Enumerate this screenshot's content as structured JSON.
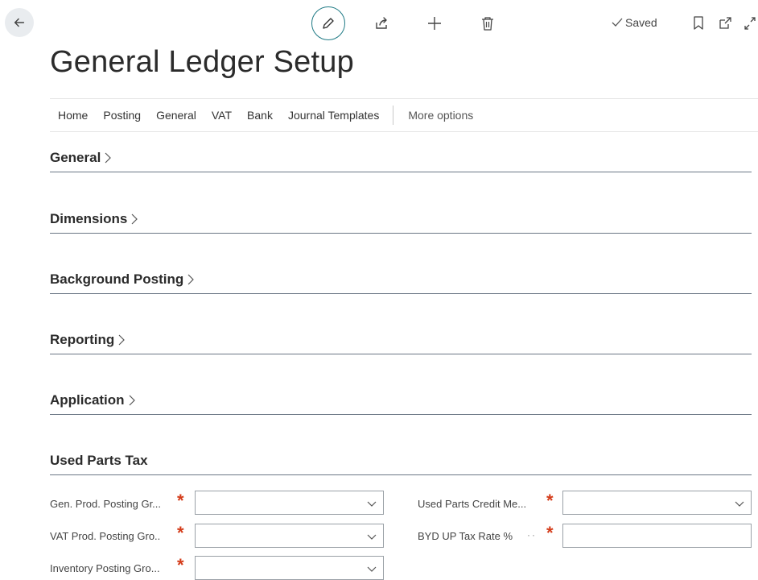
{
  "page": {
    "title": "General Ledger Setup",
    "status": "Saved"
  },
  "action_bar": {
    "items": [
      "Home",
      "Posting",
      "General",
      "VAT",
      "Bank",
      "Journal Templates"
    ],
    "more": "More options"
  },
  "fasttabs": [
    {
      "title": "General"
    },
    {
      "title": "Dimensions"
    },
    {
      "title": "Background Posting"
    },
    {
      "title": "Reporting"
    },
    {
      "title": "Application"
    },
    {
      "title": "Used Parts Tax"
    }
  ],
  "used_parts_tax": {
    "fields": [
      {
        "label": "Gen. Prod. Posting Gr...",
        "value": "",
        "required": "*"
      },
      {
        "label": "VAT Prod. Posting Gro..",
        "value": "",
        "required": "*"
      },
      {
        "label": "Inventory Posting Gro...",
        "value": "",
        "required": "*"
      },
      {
        "label": "Used Parts Credit Me...",
        "value": "",
        "required": "*"
      },
      {
        "label": "BYD UP Tax Rate %",
        "value": "",
        "required": "*"
      }
    ]
  },
  "icons": {
    "back": "back-arrow-icon",
    "edit": "pencil-icon",
    "share": "share-icon",
    "new": "plus-icon",
    "delete": "trash-icon",
    "saved": "checkmark-icon",
    "bookmark": "bookmark-icon",
    "popout": "open-new-window-icon",
    "expand": "expand-icon"
  },
  "colors": {
    "accent": "#1f7a85",
    "required": "#d43c1a",
    "tab_underline": "#6b7785"
  }
}
